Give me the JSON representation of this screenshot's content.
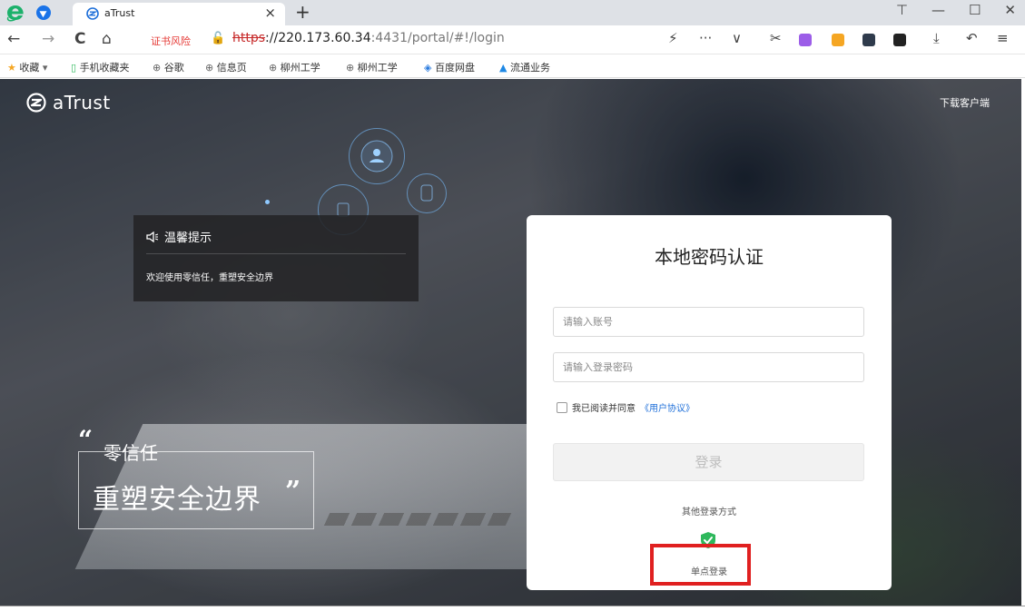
{
  "browser": {
    "tab_title": "aTrust",
    "tab_close": "×",
    "new_tab": "+",
    "window_controls": [
      "⊤",
      "—",
      "☐",
      "✕"
    ],
    "nav": {
      "back": "←",
      "forward": "→",
      "reload": "C",
      "home": "⌂"
    },
    "cert_warning": "证书风险",
    "url_scheme": "https",
    "url_host": "://220.173.60.34",
    "url_path": ":4431/portal/#!/login",
    "toolbar_glyphs": {
      "lightning": "⚡",
      "more": "···",
      "chevron": "∨",
      "cut": "✂",
      "download": "⤓",
      "undo": "↶",
      "menu": "≡"
    },
    "bookmarks": [
      {
        "label": "收藏",
        "icon": "star-icon"
      },
      {
        "label": "手机收藏夹",
        "icon": "phone-icon"
      },
      {
        "label": "谷歌",
        "icon": "globe-icon"
      },
      {
        "label": "信息页",
        "icon": "globe-icon"
      },
      {
        "label": "柳州工学",
        "icon": "globe-icon"
      },
      {
        "label": "柳州工学",
        "icon": "globe-icon"
      },
      {
        "label": "百度网盘",
        "icon": "baidu-pan-icon"
      },
      {
        "label": "流通业务",
        "icon": "triangle-icon"
      }
    ]
  },
  "header": {
    "brand": "aTrust",
    "download_client": "下载客户端"
  },
  "notice": {
    "title": "温馨提示",
    "text": "欢迎使用零信任，重塑安全边界"
  },
  "slogan": {
    "open_quote": "“",
    "line1": "零信任",
    "line2": "重塑安全边界",
    "close_quote": "”"
  },
  "login": {
    "title": "本地密码认证",
    "account_placeholder": "请输入账号",
    "password_placeholder": "请输入登录密码",
    "agree_text": "我已阅读并同意",
    "agreement_link": "《用户协议》",
    "login_button": "登录",
    "other_methods": "其他登录方式",
    "sso_label": "单点登录"
  },
  "colors": {
    "accent_link": "#1e6fd9",
    "sso_green": "#2eb85c",
    "highlight_red": "#e02020",
    "cert_warning": "#e53935"
  }
}
